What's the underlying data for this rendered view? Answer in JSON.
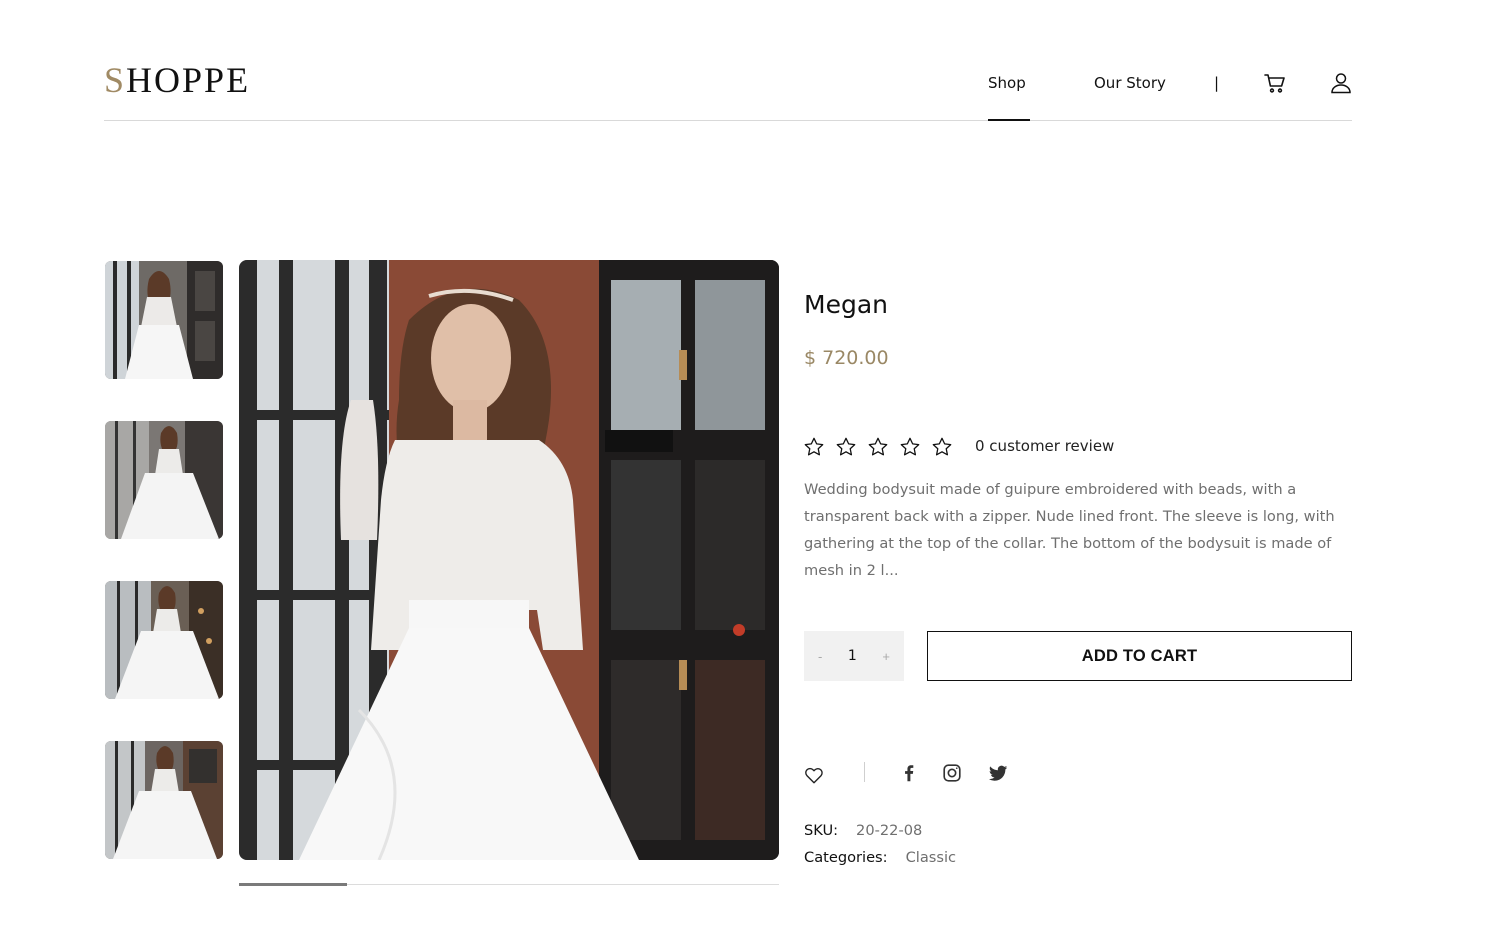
{
  "brand": {
    "logo_first": "S",
    "logo_rest": "HOPPE",
    "accent_color": "#a08a64"
  },
  "nav": {
    "shop_label": "Shop",
    "story_label": "Our Story",
    "separator": "|",
    "cart_icon": "cart-icon",
    "account_icon": "user-icon"
  },
  "gallery": {
    "thumbnails": [
      "thumb-1",
      "thumb-2",
      "thumb-3",
      "thumb-4"
    ],
    "active_index": 0,
    "progress": 0.2
  },
  "product": {
    "title": "Megan",
    "price": "$ 720.00",
    "price_color": "#9a8865",
    "rating": 0,
    "rating_max": 5,
    "review_text": "0 customer review",
    "description": "Wedding bodysuit made of guipure embroidered with beads, with a transparent back with a zipper. Nude lined front. The sleeve is long, with gathering at the top of the collar. The bottom of the bodysuit is made of mesh in 2 l...",
    "quantity": "1",
    "qty_minus": "-",
    "qty_plus": "+",
    "add_to_cart": "ADD TO CART",
    "sku_label": "SKU:",
    "sku_value": "20-22-08",
    "categories_label": "Categories:",
    "categories_value": "Classic"
  },
  "share": {
    "icons": [
      "heart-icon",
      "facebook-icon",
      "instagram-icon",
      "twitter-icon"
    ]
  }
}
